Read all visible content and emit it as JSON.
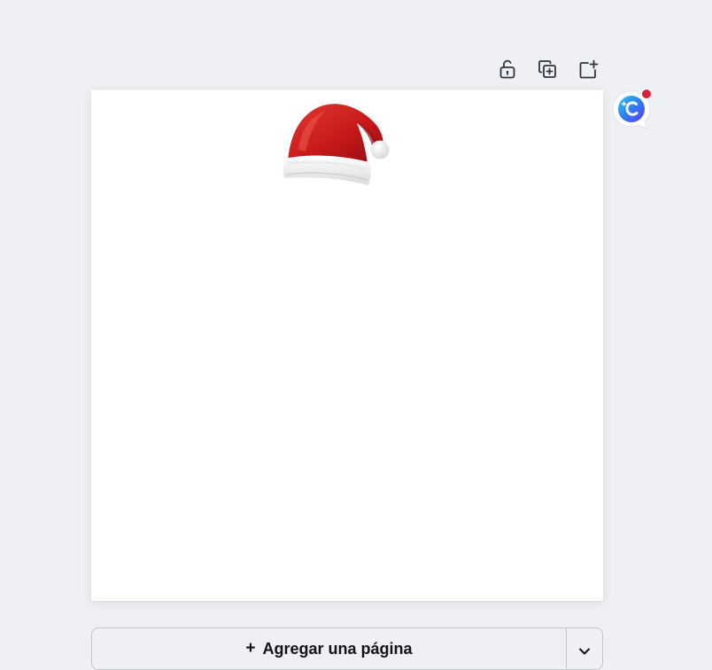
{
  "page_toolbar": {
    "lock_icon": "unlock-icon",
    "duplicate_icon": "duplicate-page-icon",
    "add_icon": "add-page-icon"
  },
  "canvas": {
    "background_color": "#ffffff",
    "element": "santa-hat"
  },
  "assistant": {
    "icon": "assistant-logo-icon",
    "has_notification": true,
    "notification_color": "#d61f3b"
  },
  "add_page": {
    "plus": "+",
    "label": "Agregar una página",
    "dropdown_icon": "chevron-down-icon"
  },
  "colors": {
    "workspace_bg": "#eef0f4",
    "icon_color": "#2e3440",
    "border": "#c2c6cd"
  }
}
